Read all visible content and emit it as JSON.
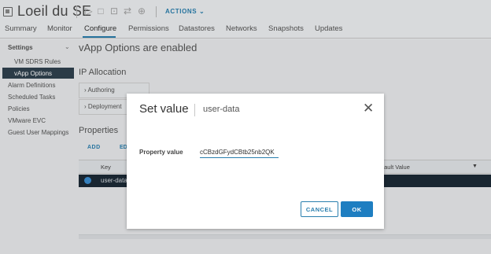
{
  "header": {
    "vm_title": "Loeil du SE",
    "actions_label": "ACTIONS ⌄",
    "toolbar_icons": [
      "power-on-icon",
      "power-off-icon",
      "console-icon",
      "migrate-icon",
      "snapshot-icon"
    ]
  },
  "tabs": [
    {
      "label": "Summary"
    },
    {
      "label": "Monitor"
    },
    {
      "label": "Configure",
      "active": true
    },
    {
      "label": "Permissions"
    },
    {
      "label": "Datastores"
    },
    {
      "label": "Networks"
    },
    {
      "label": "Snapshots"
    },
    {
      "label": "Updates"
    }
  ],
  "sidebar": {
    "section": "Settings",
    "items": [
      {
        "label": "VM SDRS Rules"
      },
      {
        "label": "vApp Options",
        "selected": true
      },
      {
        "label": "Alarm Definitions"
      },
      {
        "label": "Scheduled Tasks"
      },
      {
        "label": "Policies"
      },
      {
        "label": "VMware EVC"
      },
      {
        "label": "Guest User Mappings"
      }
    ]
  },
  "main": {
    "heading": "vApp Options are enabled",
    "ip_allocation": "IP Allocation",
    "accordions": [
      "Authoring",
      "Deployment"
    ],
    "properties": "Properties",
    "add_label": "ADD",
    "edit_label": "ED",
    "table": {
      "col_key": "Key",
      "col_default": "fault Value",
      "row_key": "user-data"
    }
  },
  "modal": {
    "title": "Set value",
    "subtitle": "user-data",
    "property_label": "Property value",
    "property_value": "cCBzdGFydCBtb25nb2QK",
    "cancel_label": "CANCEL",
    "ok_label": "OK"
  },
  "colors": {
    "accent": "#2a7fae",
    "primary_button": "#1e7ec1",
    "selected_sidebar": "#30414f",
    "selected_row": "#1c2a36"
  }
}
